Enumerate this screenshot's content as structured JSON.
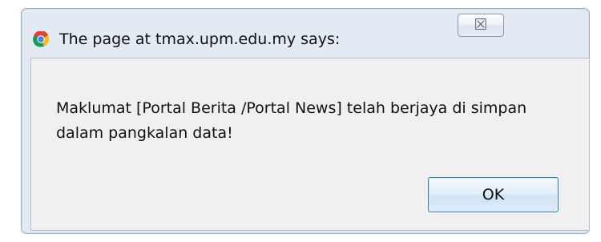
{
  "dialog": {
    "title": "The page at tmax.upm.edu.my says:",
    "message": "Maklumat [Portal Berita /Portal News] telah berjaya di simpan dalam pangkalan data!",
    "ok_label": "OK",
    "close_symbol": "☒"
  },
  "icons": {
    "app_icon": "chrome-icon",
    "close_icon": "close-icon"
  },
  "colors": {
    "frame": "#e4eaf3",
    "content_background": "#f0f0f0",
    "ok_border": "#3c7fb1"
  }
}
